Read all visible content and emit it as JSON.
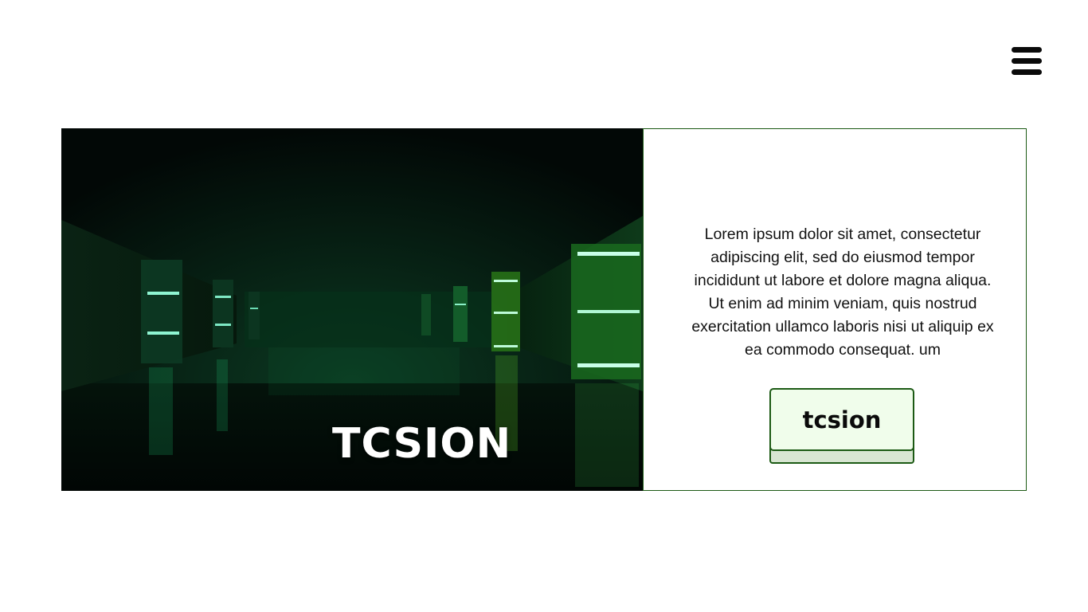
{
  "header": {
    "menu_icon": "hamburger-menu-icon"
  },
  "hero": {
    "title": "TCSION"
  },
  "card": {
    "description": "Lorem ipsum dolor sit amet, consectetur adipiscing elit, sed do eiusmod tempor incididunt ut labore et dolore magna aliqua. Ut enim ad minim veniam, quis nostrud exercitation ullamco laboris nisi ut aliquip ex ea commodo consequat. um",
    "button_label": "tcsion"
  },
  "colors": {
    "accent_border": "#1c5a14",
    "button_face": "#f0fdeb",
    "button_base": "#d8e6d2",
    "hero_glow": "#1fd27a"
  }
}
